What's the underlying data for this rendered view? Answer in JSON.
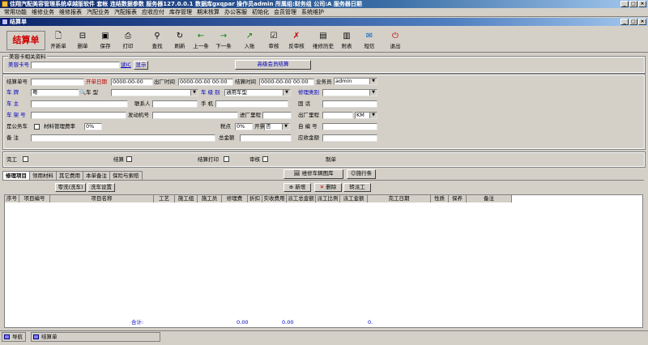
{
  "app": {
    "title": "佳翔汽配美容管理系统卓越版软件   套帐 连结数据参数   服务器127.0.0.1  数据库gxqpar  操作员admin  所属组:财务组  公司:A  服务器日期"
  },
  "menu": [
    "常用功能",
    "维修业务",
    "维修报表",
    "汽配业务",
    "汽配报表",
    "应收应付",
    "库存管理",
    "期末核算",
    "办公客服",
    "初始化",
    "会员管理",
    "系统维护"
  ],
  "child_title": "结算单",
  "brand": "结算单",
  "toolbar": {
    "new": "开新单",
    "delete": "删单",
    "save": "保存",
    "print": "打印",
    "find": "查找",
    "refresh": "刷新",
    "prev": "上一条",
    "next": "下一条",
    "post": "入账",
    "audit": "审核",
    "unaudit": "反审核",
    "history": "维修历史",
    "attach": "附表",
    "sms": "短信",
    "exit": "退出"
  },
  "member": {
    "section": "美容卡相关资料",
    "card_label": "美容卡号",
    "read_card": "读IC",
    "show": "显示",
    "advanced": "高级会员结算"
  },
  "form": {
    "bill_no": "结算单号",
    "in_date": "开单日期",
    "in_date_val": "0000-00-00",
    "out_time": "出厂时间",
    "out_time_val": "0000-00-00 00:00",
    "settle_time": "结算时间",
    "settle_time_val": "0000-00-00 00:00",
    "salesman": "业务员",
    "salesman_val": "admin",
    "plate": "车  牌",
    "plate_val": "粤",
    "model": "车 型",
    "level": "车 级 别",
    "level_val": "通用车型",
    "repair_type": "修理类别",
    "owner": "车  主",
    "contact": "联系人",
    "phone": "手  机",
    "tel": "固  话",
    "vin": "车 架 号",
    "engine": "发动机号",
    "in_mileage": "进厂里程",
    "out_mileage": "出厂里程",
    "unit": "KM",
    "public_car": "是公务车",
    "mgmt_fee": "材料管理费率",
    "mgmt_fee_val": "0%",
    "tax_rate": "税点",
    "tax_rate_val": "0%",
    "invoice": "开票",
    "invoice_val": "否",
    "self_no": "自 编 号",
    "remark": "备  注",
    "total": "总金额",
    "receivable": "应收金额"
  },
  "flags": {
    "done": "完工",
    "settled": "结算",
    "settle_print": "结算打印",
    "audited": "审核",
    "maker": "制单"
  },
  "tabs": [
    "修理项目",
    "领用材料",
    "其它费用",
    "本单备注",
    "保险与索赔"
  ],
  "actions": {
    "wash": "零洗(洗车)",
    "wash_setting": "洗车设置",
    "gallery": "维修车辆图库",
    "tech": "施行条",
    "add": "新增",
    "remove": "删除",
    "dispatch": "转派工"
  },
  "grid": {
    "columns": [
      "序号",
      "项目编号",
      "项目名称",
      "工艺",
      "施工组",
      "施工员",
      "修理费",
      "折扣",
      "实收费用",
      "派工总金额",
      "派工比例",
      "派工金额",
      "完工日期",
      "性质",
      "保养",
      "备注"
    ]
  },
  "footer": {
    "sum_label": "合计:",
    "v1": "0.00",
    "v2": "0.00",
    "v3": "0."
  },
  "statusbar": {
    "nav": "导航",
    "tab": "结算单"
  },
  "colors": {
    "title_blue": "#0a246a",
    "brand_red": "#d00000",
    "label_blue": "#0000c0"
  }
}
